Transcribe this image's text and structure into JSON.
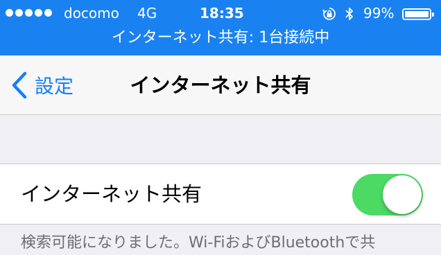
{
  "status_bar": {
    "carrier": "docomo",
    "network": "4G",
    "time": "18:35",
    "battery_percent": "99%",
    "battery_level": 0.99,
    "hotspot_banner": "インターネット共有: 1台接続中",
    "icons": [
      "signal-icon",
      "rotation-lock-icon",
      "bluetooth-icon",
      "battery-icon"
    ],
    "signal_bars": 5
  },
  "nav": {
    "back_label": "設定",
    "title": "インターネット共有"
  },
  "settings": {
    "hotspot_label": "インターネット共有",
    "hotspot_enabled": true,
    "footer_note": "検索可能になりました。Wi-FiおよびBluetoothで共"
  },
  "colors": {
    "status_bar_blue": "#1a82f0",
    "accent": "#157efb",
    "toggle_on": "#4cd964",
    "background": "#efeff4"
  }
}
